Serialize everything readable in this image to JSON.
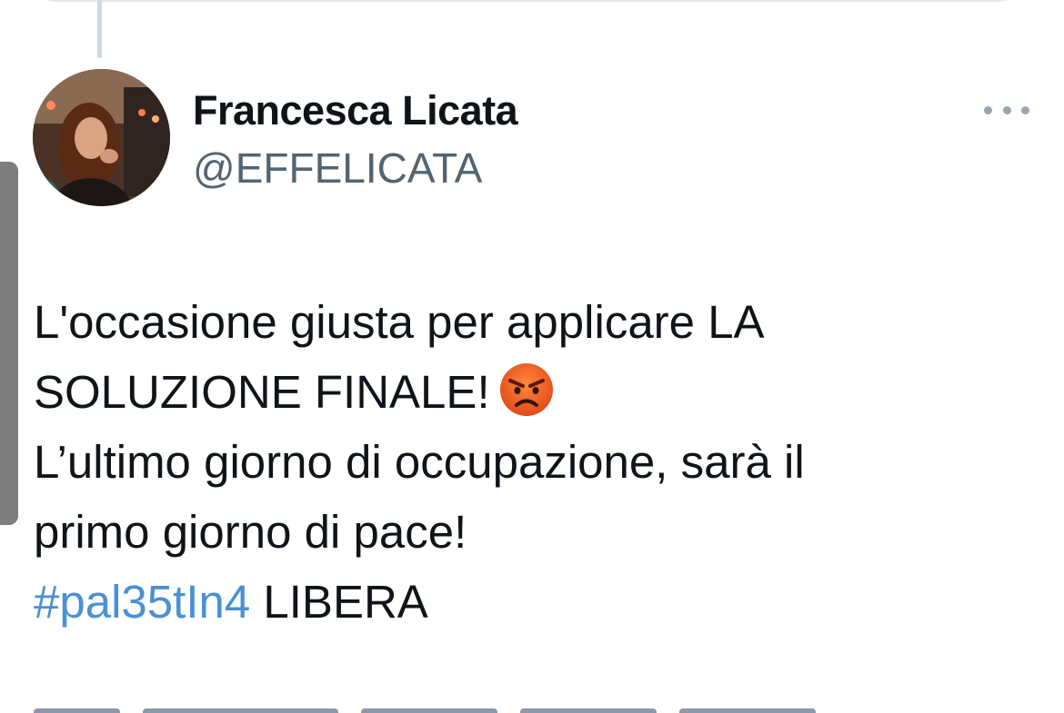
{
  "tweet": {
    "author": {
      "display_name": "Francesca Licata",
      "handle": "@EFFELICATA",
      "avatar_icon": "profile-photo"
    },
    "text_lines": [
      "L'occasione giusta per applicare LA",
      "SOLUZIONE FINALE!",
      "L’ultimo giorno di occupazione, sarà il",
      "primo giorno di pace!"
    ],
    "emoji": "angry-face",
    "hashtag": "#pal35tIn4",
    "hashtag_suffix": " LIBERA",
    "more_icon": "more-horizontal-icon"
  },
  "colors": {
    "text": "#0f1419",
    "secondary_text": "#536471",
    "link": "#4a90d4",
    "thread_line": "#cfd9de"
  }
}
